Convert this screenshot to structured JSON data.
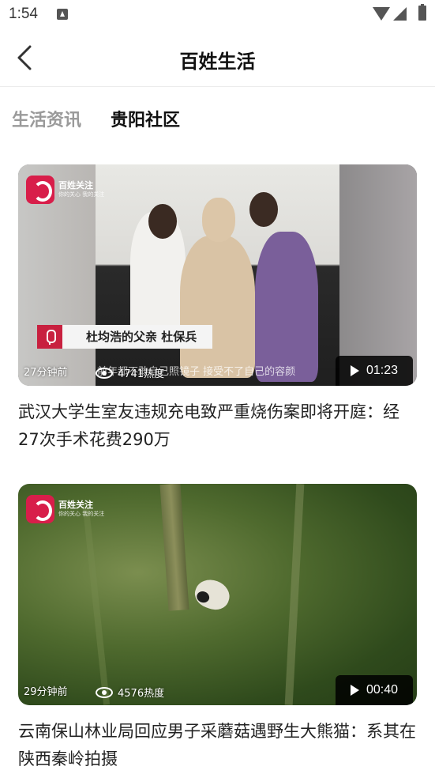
{
  "status_bar": {
    "time": "1:54"
  },
  "header": {
    "title": "百姓生活"
  },
  "tabs": [
    {
      "label": "生活资讯",
      "active": false
    },
    {
      "label": "贵阳社区",
      "active": true
    }
  ],
  "brand": {
    "name": "百姓关注",
    "tagline": "你的关心 我的关注"
  },
  "colors": {
    "accent": "#b9d3f5",
    "brand_red": "#d81e4a"
  },
  "feed": [
    {
      "caption_name": "杜均浩的父亲 杜保兵",
      "subtitle": "前年都不敢自己照镜子 接受不了自己的容颜",
      "time_ago": "27分钟前",
      "views": "4741热度",
      "duration": "01:23",
      "title": "武汉大学生室友违规充电致严重烧伤案即将开庭：经27次手术花费290万"
    },
    {
      "time_ago": "29分钟前",
      "views": "4576热度",
      "duration": "00:40",
      "title": "云南保山林业局回应男子采蘑菇遇野生大熊猫：系其在陕西秦岭拍摄"
    }
  ]
}
